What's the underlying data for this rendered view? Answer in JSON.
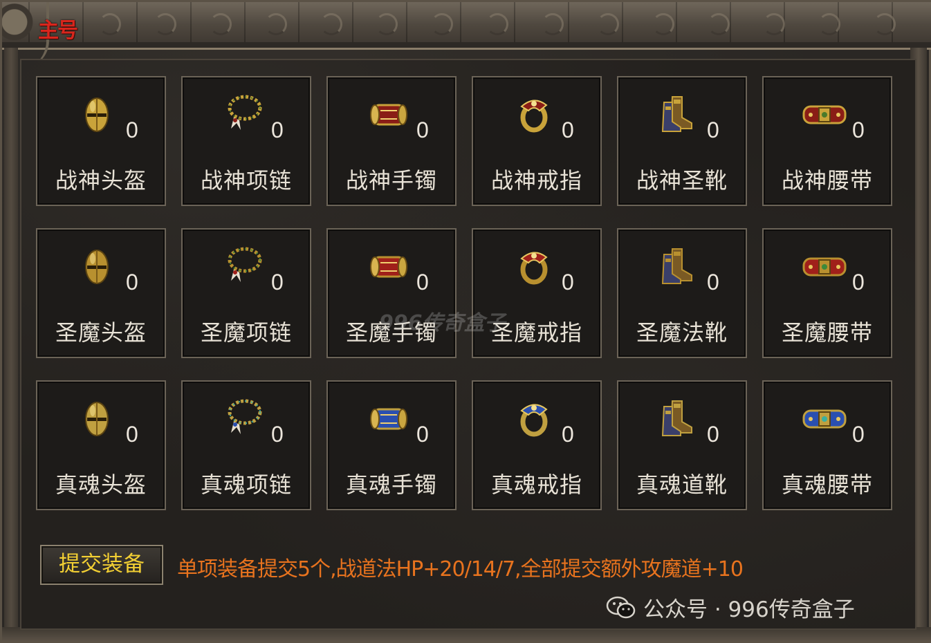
{
  "header": {
    "logo_text": "主号"
  },
  "grid": [
    [
      {
        "name": "战神头盔",
        "count": "0",
        "icon": "helmet-icon"
      },
      {
        "name": "战神项链",
        "count": "0",
        "icon": "necklace-icon"
      },
      {
        "name": "战神手镯",
        "count": "0",
        "icon": "bracelet-icon"
      },
      {
        "name": "战神戒指",
        "count": "0",
        "icon": "ring-icon"
      },
      {
        "name": "战神圣靴",
        "count": "0",
        "icon": "boots-icon"
      },
      {
        "name": "战神腰带",
        "count": "0",
        "icon": "belt-icon"
      }
    ],
    [
      {
        "name": "圣魔头盔",
        "count": "0",
        "icon": "helmet-icon"
      },
      {
        "name": "圣魔项链",
        "count": "0",
        "icon": "necklace-icon"
      },
      {
        "name": "圣魔手镯",
        "count": "0",
        "icon": "bracelet-icon"
      },
      {
        "name": "圣魔戒指",
        "count": "0",
        "icon": "ring-icon"
      },
      {
        "name": "圣魔法靴",
        "count": "0",
        "icon": "boots-icon"
      },
      {
        "name": "圣魔腰带",
        "count": "0",
        "icon": "belt-icon"
      }
    ],
    [
      {
        "name": "真魂头盔",
        "count": "0",
        "icon": "helmet-icon"
      },
      {
        "name": "真魂项链",
        "count": "0",
        "icon": "necklace-icon"
      },
      {
        "name": "真魂手镯",
        "count": "0",
        "icon": "bracelet-icon"
      },
      {
        "name": "真魂戒指",
        "count": "0",
        "icon": "ring-icon"
      },
      {
        "name": "真魂道靴",
        "count": "0",
        "icon": "boots-icon"
      },
      {
        "name": "真魂腰带",
        "count": "0",
        "icon": "belt-icon"
      }
    ]
  ],
  "footer": {
    "submit_label": "提交装备",
    "info": "单项装备提交5个,战道法HP+20/14/7,全部提交额外攻魔道+10"
  },
  "watermarks": {
    "corner": "公众号 · 996传奇盒子",
    "center": "996传奇盒子"
  },
  "colors": {
    "submit_text": "#f2cf33",
    "info_text": "#e8731e",
    "logo": "#d8261d"
  }
}
